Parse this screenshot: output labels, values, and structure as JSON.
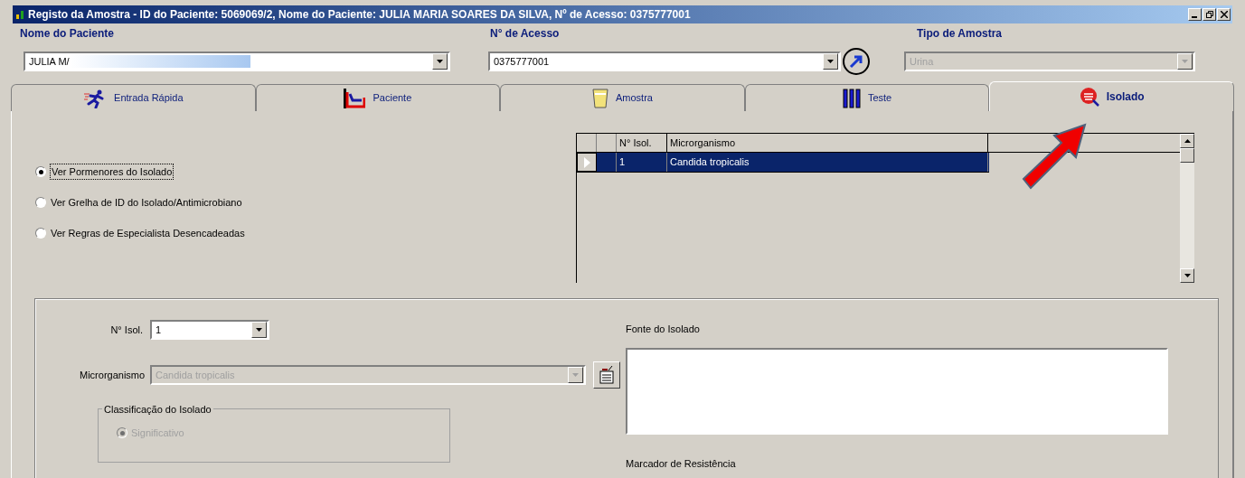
{
  "window": {
    "title": "Registo da Amostra -  ID do Paciente: 5069069/2,  Nome do Paciente: JULIA MARIA SOARES DA SILVA,  Nº de Acesso: 0375777001"
  },
  "header": {
    "patient": {
      "label": "Nome do Paciente",
      "value": "JULIA M/"
    },
    "access": {
      "label": "N° de Acesso",
      "value": "0375777001"
    },
    "sample_type": {
      "label": "Tipo de Amostra",
      "value": "Urina",
      "disabled": true
    }
  },
  "tabs": [
    {
      "label": "Entrada Rápida",
      "kind": "runner",
      "selected": false
    },
    {
      "label": "Paciente",
      "kind": "bed",
      "selected": false
    },
    {
      "label": "Amostra",
      "kind": "cup",
      "selected": false
    },
    {
      "label": "Teste",
      "kind": "tubes",
      "selected": false
    },
    {
      "label": "Isolado",
      "kind": "bug",
      "selected": true
    }
  ],
  "view_options": [
    {
      "label": "Ver Pormenores do Isolado",
      "selected": true
    },
    {
      "label": "Ver Grelha de ID do Isolado/Antimicrobiano",
      "selected": false
    },
    {
      "label": "Ver Regras de Especialista Desencadeadas",
      "selected": false
    }
  ],
  "isolates_table": {
    "columns": [
      "N° Isol.",
      "Microrganismo"
    ],
    "rows": [
      {
        "cells": [
          "1",
          "Candida tropicalis"
        ],
        "selected": true
      }
    ]
  },
  "details": {
    "isolate_no": {
      "label": "N° Isol.",
      "value": "1"
    },
    "organism": {
      "label": "Microrganismo",
      "value": "Candida tropicalis",
      "disabled": true
    },
    "source": {
      "label": "Fonte do Isolado"
    },
    "classification": {
      "title": "Classificação do Isolado",
      "option": "Significativo",
      "selected": true,
      "disabled": true
    },
    "resistance": {
      "label": "Marcador de Resistência"
    }
  }
}
